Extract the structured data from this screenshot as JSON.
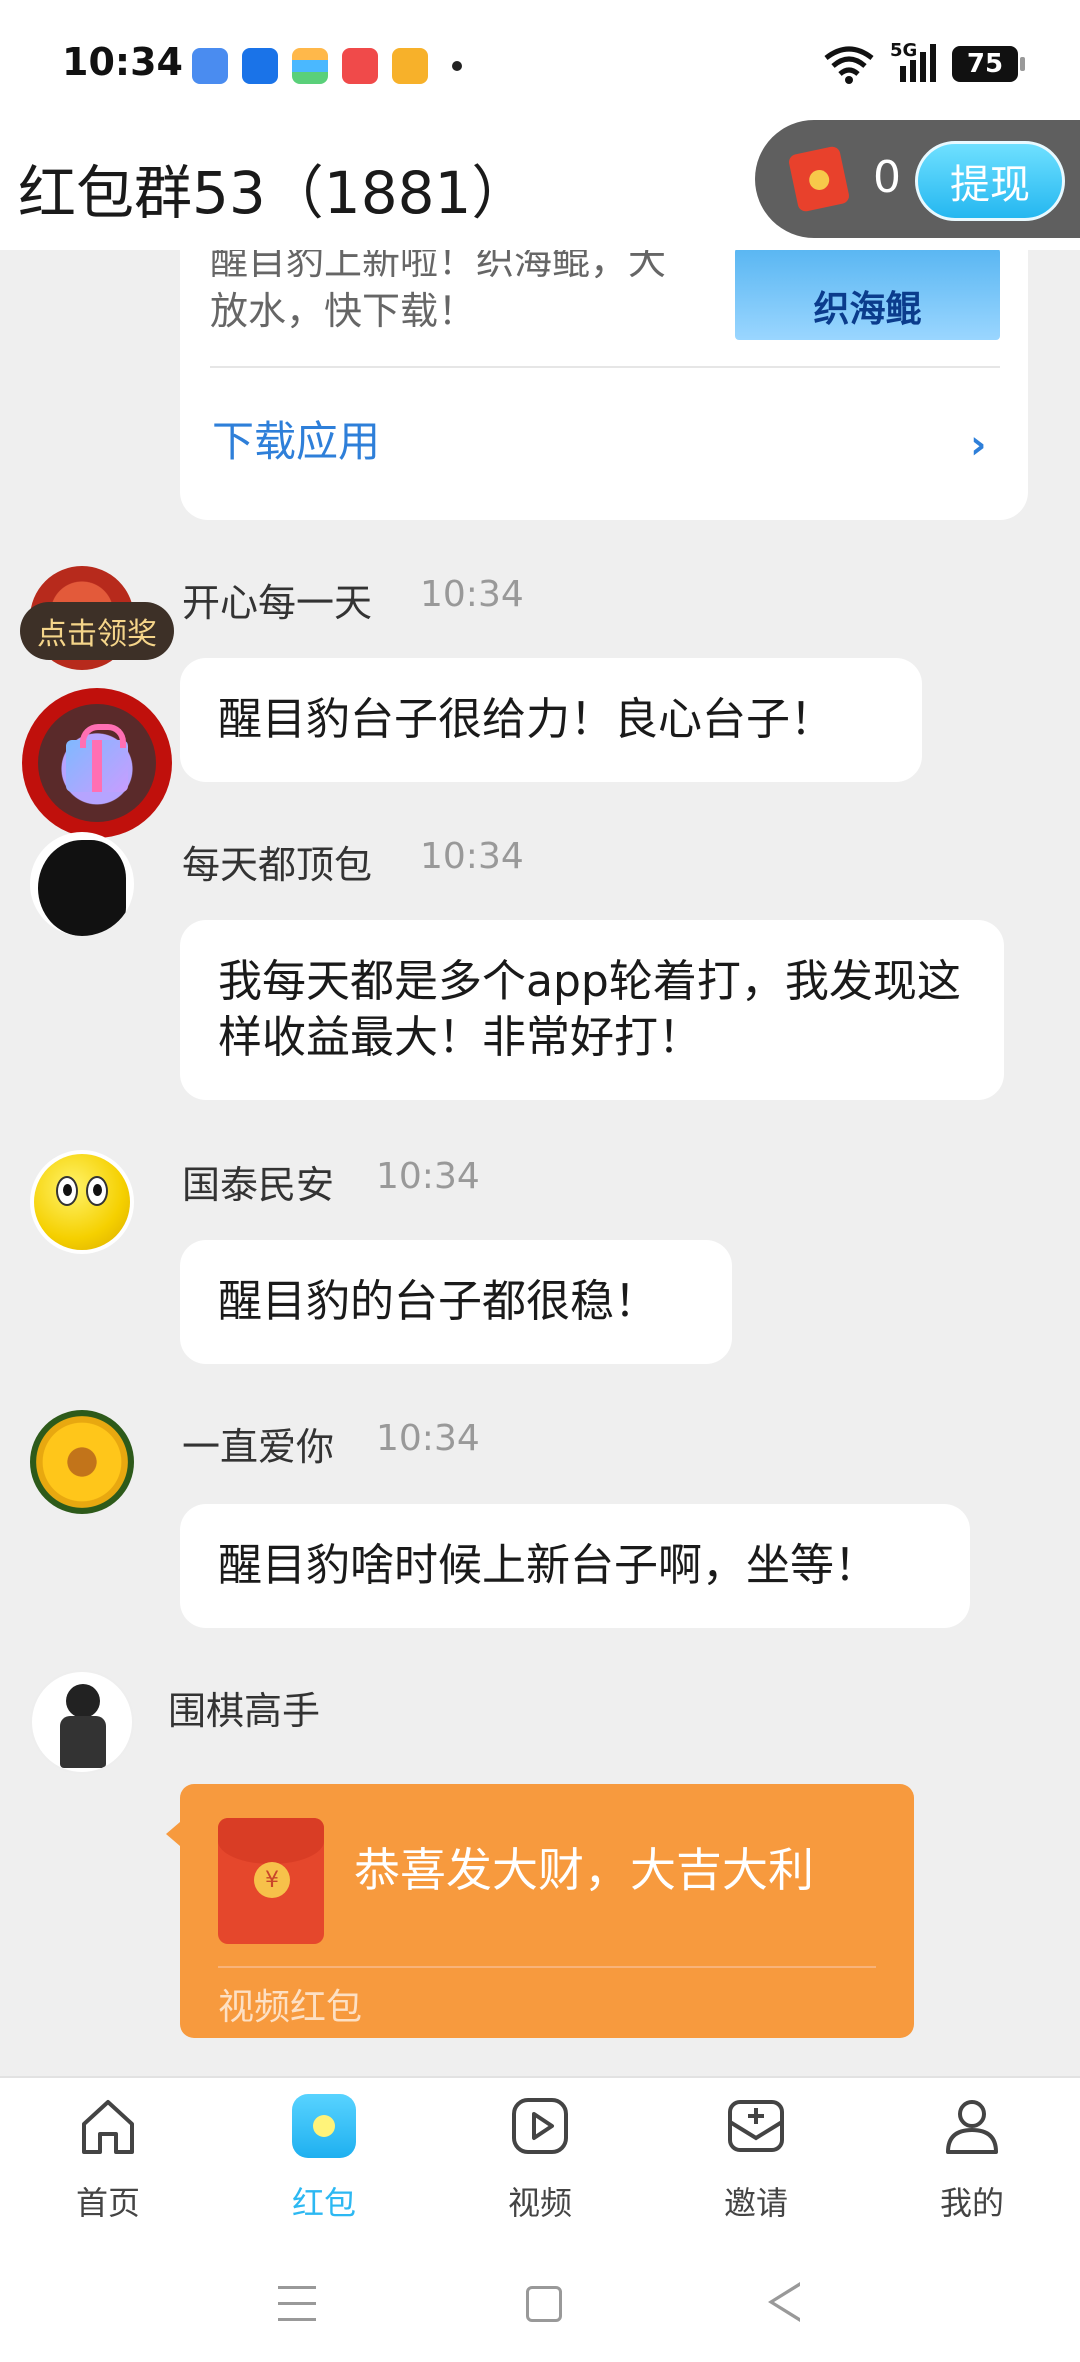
{
  "status_bar": {
    "time": "10:34",
    "network": "5G",
    "battery": "75",
    "app_icons": [
      "messages-icon",
      "alipay-icon",
      "wallet-icon",
      "video-app-icon",
      "weibo-icon"
    ]
  },
  "header": {
    "title": "红包群53（1881）",
    "wallet_count": "0",
    "withdraw_label": "提现"
  },
  "ad_card": {
    "text": "醒目豹上新啦！织海鲲，大放水，快下载！",
    "image_caption": "织海鲲",
    "download_label": "下载应用"
  },
  "claim_badge": "点击领奖",
  "messages": [
    {
      "name": "开心每一天",
      "time": "10:34",
      "text": "醒目豹台子很给力！良心台子！"
    },
    {
      "name": "每天都顶包",
      "time": "10:34",
      "text": "我每天都是多个app轮着打，我发现这样收益最大！非常好打！"
    },
    {
      "name": "国泰民安",
      "time": "10:34",
      "text": "醒目豹的台子都很稳！"
    },
    {
      "name": "一直爱你",
      "time": "10:34",
      "text": "醒目豹啥时候上新台子啊，坐等！"
    },
    {
      "name": "围棋高手",
      "time": "",
      "text": ""
    }
  ],
  "red_envelope": {
    "title": "恭喜发大财，大吉大利",
    "subtitle": "视频红包",
    "coin_symbol": "¥"
  },
  "tabs": [
    {
      "label": "首页",
      "icon": "home-icon",
      "active": false
    },
    {
      "label": "红包",
      "icon": "red-packet-icon",
      "active": true
    },
    {
      "label": "视频",
      "icon": "video-icon",
      "active": false
    },
    {
      "label": "邀请",
      "icon": "invite-icon",
      "active": false
    },
    {
      "label": "我的",
      "icon": "profile-icon",
      "active": false
    }
  ],
  "colors": {
    "accent": "#2cb8f2",
    "envelope_card": "#f79a3e",
    "link_blue": "#2e7fd9"
  }
}
